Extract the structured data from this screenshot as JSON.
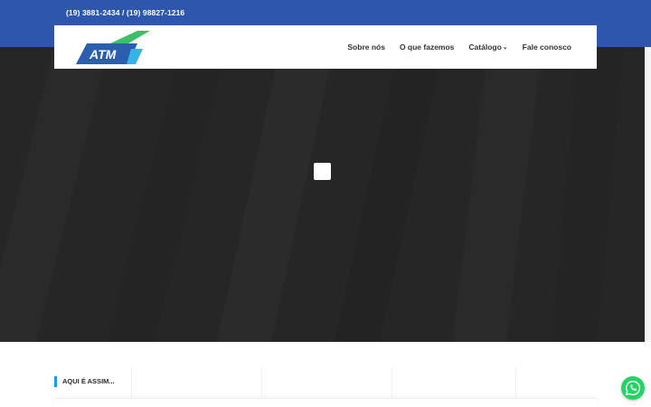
{
  "topbar": {
    "phone": "(19) 3881-2434 / (19) 98827-1216"
  },
  "logo": {
    "text": "ATM"
  },
  "nav": {
    "items": [
      {
        "label": "Sobre nós"
      },
      {
        "label": "O que fazemos"
      },
      {
        "label": "Catálogo",
        "chevron": "chevron-down-icon"
      },
      {
        "label": "Fale conosco"
      }
    ]
  },
  "section": {
    "title": "AQUI É ASSIM..."
  },
  "colors": {
    "topbar": "#2d57ac",
    "hero": "#262626",
    "accent": "#1e9be6",
    "logo_green": "#3dbf6a",
    "whatsapp": "#25d366"
  },
  "icons": {
    "whatsapp": "whatsapp-icon",
    "loader": "loading-spinner"
  }
}
